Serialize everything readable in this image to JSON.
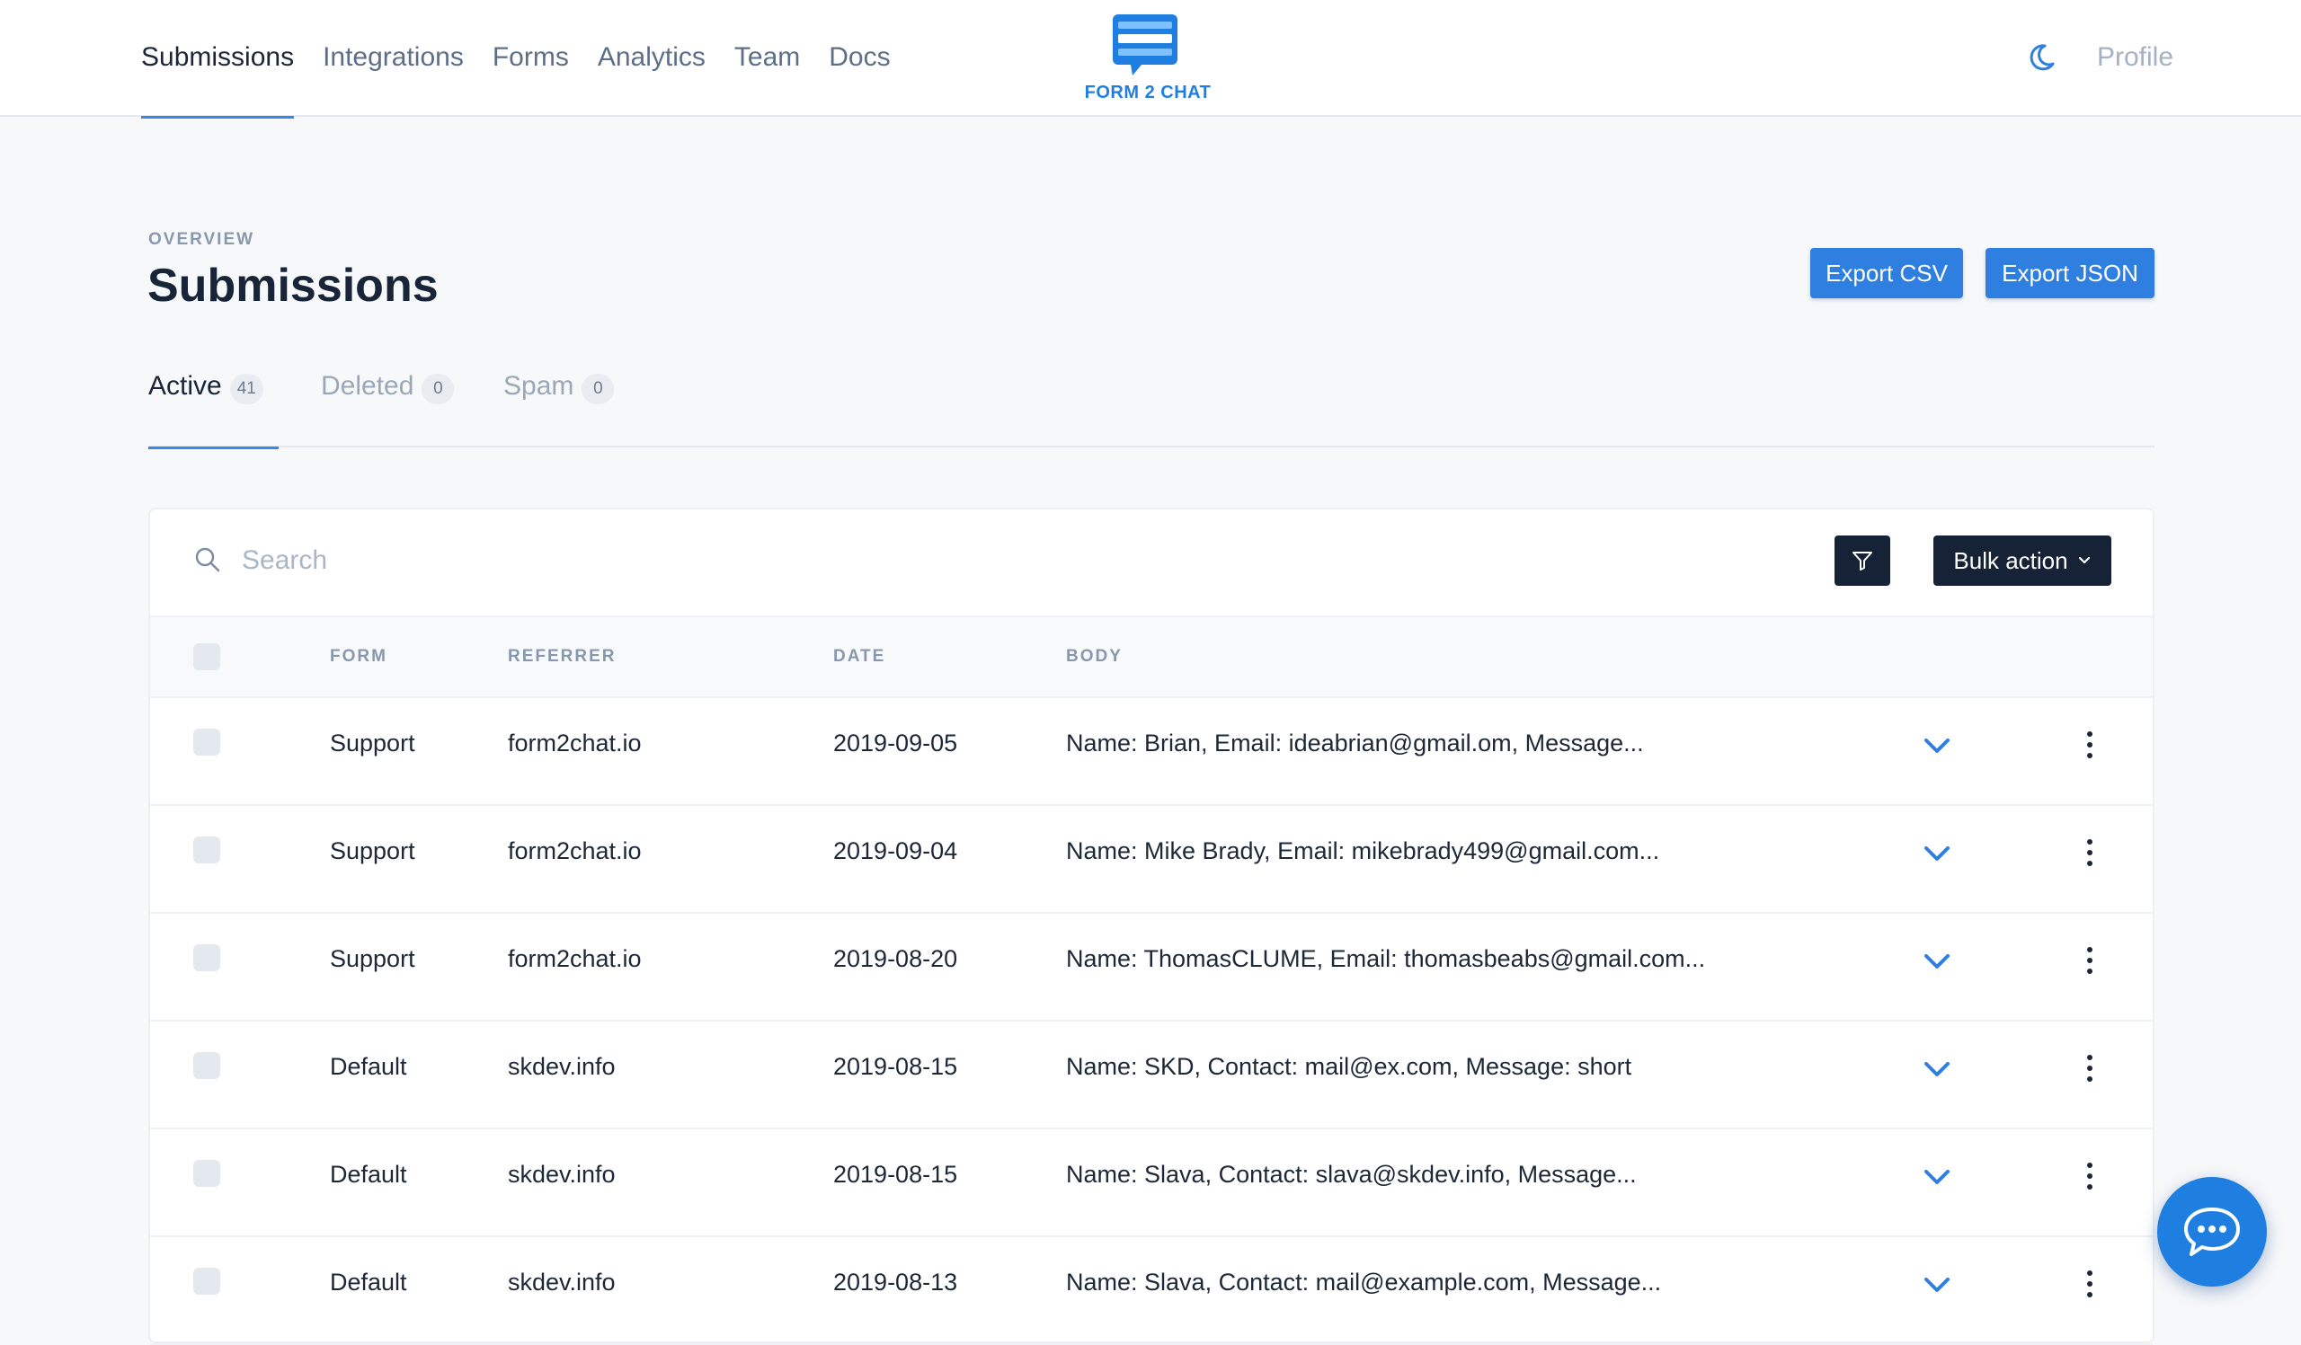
{
  "nav": {
    "items": [
      {
        "label": "Submissions",
        "active": true
      },
      {
        "label": "Integrations",
        "active": false
      },
      {
        "label": "Forms",
        "active": false
      },
      {
        "label": "Analytics",
        "active": false
      },
      {
        "label": "Team",
        "active": false
      },
      {
        "label": "Docs",
        "active": false
      }
    ],
    "logo_text": "FORM 2 CHAT",
    "theme_icon": "moon-icon",
    "profile_label": "Profile"
  },
  "header": {
    "overline": "OVERVIEW",
    "title": "Submissions",
    "export_csv_label": "Export CSV",
    "export_json_label": "Export JSON"
  },
  "tabs": [
    {
      "label": "Active",
      "count": "41",
      "active": true
    },
    {
      "label": "Deleted",
      "count": "0",
      "active": false
    },
    {
      "label": "Spam",
      "count": "0",
      "active": false
    }
  ],
  "toolbar": {
    "search_placeholder": "Search",
    "filter_icon": "filter-icon",
    "bulk_action_label": "Bulk action"
  },
  "table": {
    "columns": [
      "FORM",
      "REFERRER",
      "DATE",
      "BODY"
    ],
    "rows": [
      {
        "form": "Support",
        "referrer": "form2chat.io",
        "date": "2019-09-05",
        "body": "Name: Brian, Email: ideabrian@gmail.om, Message..."
      },
      {
        "form": "Support",
        "referrer": "form2chat.io",
        "date": "2019-09-04",
        "body": "Name: Mike Brady, Email: mikebrady499@gmail.com..."
      },
      {
        "form": "Support",
        "referrer": "form2chat.io",
        "date": "2019-08-20",
        "body": "Name: ThomasCLUME, Email: thomasbeabs@gmail.com..."
      },
      {
        "form": "Default",
        "referrer": "skdev.info",
        "date": "2019-08-15",
        "body": "Name: SKD, Contact: mail@ex.com, Message: short"
      },
      {
        "form": "Default",
        "referrer": "skdev.info",
        "date": "2019-08-15",
        "body": "Name: Slava, Contact: slava@skdev.info, Message..."
      },
      {
        "form": "Default",
        "referrer": "skdev.info",
        "date": "2019-08-13",
        "body": "Name: Slava, Contact: mail@example.com, Message..."
      }
    ]
  },
  "colors": {
    "accent": "#2f7fe0",
    "dark_button": "#162236",
    "text_primary": "#1b2738",
    "text_muted": "#5d6f88"
  },
  "chat_widget_icon": "chat-bubble-icon"
}
